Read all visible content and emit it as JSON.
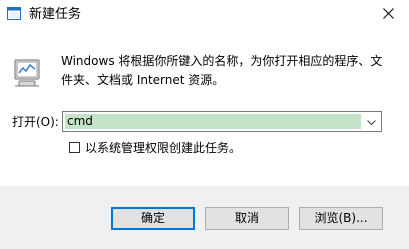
{
  "window": {
    "title": "新建任务"
  },
  "dialog": {
    "description": "Windows 将根据你所键入的名称，为你打开相应的程序、文件夹、文档或 Internet 资源。",
    "open_label": "打开(O):",
    "open_value": "cmd",
    "admin_checkbox_label": "以系统管理权限创建此任务。",
    "admin_checkbox_checked": false
  },
  "buttons": {
    "ok": "确定",
    "cancel": "取消",
    "browse": "浏览(B)..."
  },
  "colors": {
    "input_highlight": "#c4e3c8",
    "default_button_border": "#0078d7",
    "dialog_background": "#f0f0f0"
  },
  "icons": {
    "title": "run-dialog-icon",
    "main": "run-dialog-icon",
    "close": "close-icon",
    "dropdown": "chevron-down-icon"
  }
}
